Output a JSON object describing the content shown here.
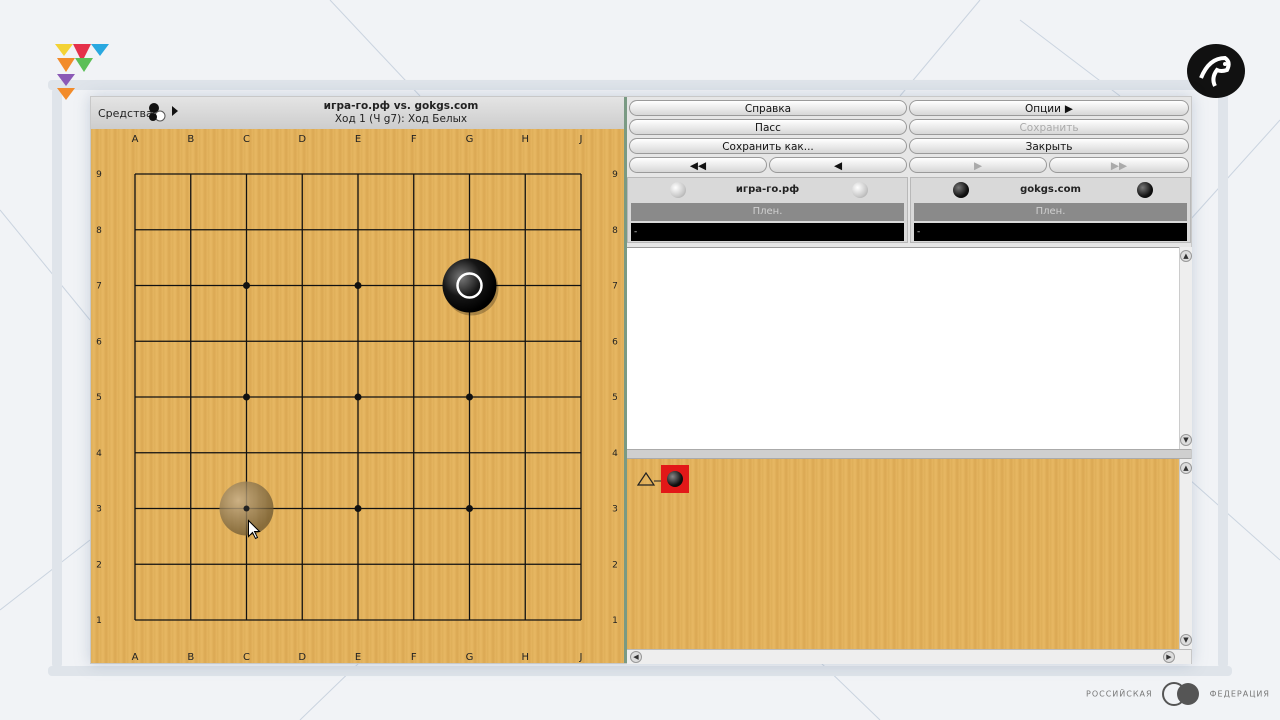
{
  "toolbar": {
    "tools_label": "Средства"
  },
  "game": {
    "title": "игра-го.рф vs. gokgs.com",
    "status": "Ход 1 (Ч g7): Ход Белых"
  },
  "board": {
    "columns": [
      "A",
      "B",
      "C",
      "D",
      "E",
      "F",
      "G",
      "H",
      "J"
    ],
    "rows": [
      "9",
      "8",
      "7",
      "6",
      "5",
      "4",
      "3",
      "2",
      "1"
    ],
    "last_move": "G7",
    "last_move_color": "black",
    "hover_stone": "C3"
  },
  "buttons": {
    "help": "Справка",
    "options": "Опции",
    "pass": "Пасс",
    "save": "Сохранить",
    "save_as": "Сохранить как...",
    "close": "Закрыть",
    "nav_first": "◀◀",
    "nav_prev": "◀",
    "nav_next": "▶",
    "nav_last": "▶▶"
  },
  "players": {
    "white": {
      "name": "игра-го.рф",
      "captures": "Плен.",
      "time": "-"
    },
    "black": {
      "name": "gokgs.com",
      "captures": "Плен.",
      "time": "-"
    }
  },
  "footer": {
    "left": "РОССИЙСКАЯ",
    "right": "ФЕДЕРАЦИЯ"
  },
  "colors": {
    "board": "#e2b05c",
    "node_highlight": "#e21818",
    "divider": "#7a9a83"
  }
}
